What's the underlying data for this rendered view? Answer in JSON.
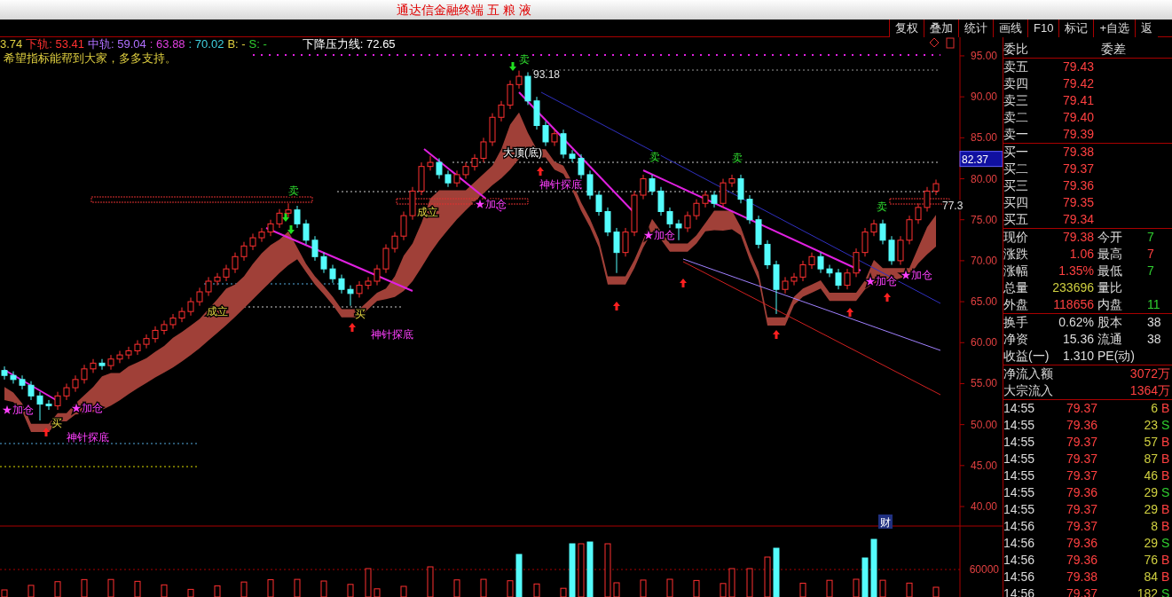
{
  "window": {
    "title": "通达信金融终端 五 粮 液"
  },
  "toolbar": [
    "复权",
    "叠加",
    "统计",
    "画线",
    "F10",
    "标记",
    "+自选",
    "返"
  ],
  "legend": [
    {
      "text": "3.74",
      "color": "#e0d040"
    },
    {
      "text": "下轨: 53.41",
      "color": "#ff3030"
    },
    {
      "text": "中轨: 59.04",
      "color": "#b070ff"
    },
    {
      "text": ": 63.88",
      "color": "#e040e0"
    },
    {
      "text": ": 70.02",
      "color": "#40d0e0"
    },
    {
      "text": "B: -",
      "color": "#e0d040"
    },
    {
      "text": "S: -",
      "color": "#30d030"
    },
    {
      "text": "下降压力线: 72.65",
      "color": "#ffffff"
    }
  ],
  "note": "希望指标能帮到大家，多多支持。",
  "annotations": [
    {
      "text": "卖",
      "kind": "sell"
    },
    {
      "text": "93.18",
      "kind": "price"
    },
    {
      "text": "大顶(底)",
      "kind": "top"
    },
    {
      "text": "神针探底",
      "kind": "probe"
    },
    {
      "text": "卖",
      "kind": "sell"
    },
    {
      "text": "卖",
      "kind": "sell"
    },
    {
      "text": "卖",
      "kind": "sell"
    },
    {
      "text": "卖",
      "kind": "sell"
    },
    {
      "text": "成立",
      "kind": "confirm"
    },
    {
      "text": "成立",
      "kind": "confirm"
    },
    {
      "text": "★加仓",
      "kind": "add"
    },
    {
      "text": "★加仓",
      "kind": "add"
    },
    {
      "text": "★加仓",
      "kind": "add"
    },
    {
      "text": "★加仓",
      "kind": "add"
    },
    {
      "text": "★加仓",
      "kind": "add"
    },
    {
      "text": "★加仓",
      "kind": "add"
    },
    {
      "text": "神针探底",
      "kind": "probe"
    },
    {
      "text": "神针探底",
      "kind": "probe"
    },
    {
      "text": "77.3",
      "kind": "price"
    },
    {
      "text": "买",
      "kind": "buy"
    },
    {
      "text": "买",
      "kind": "buy"
    }
  ],
  "chart_data": {
    "type": "candlestick",
    "ylim": [
      28.96,
      97.27
    ],
    "yticks": [
      {
        "value": 95,
        "label": "95.00"
      },
      {
        "value": 90,
        "label": "90.00"
      },
      {
        "value": 85,
        "label": "85.00"
      },
      {
        "value": 80,
        "label": "80.00"
      },
      {
        "value": 75,
        "label": "75.00"
      },
      {
        "value": 70,
        "label": "70.00"
      },
      {
        "value": 65,
        "label": "65.00"
      },
      {
        "value": 60,
        "label": "60.00"
      },
      {
        "value": 55,
        "label": "55.00"
      },
      {
        "value": 50,
        "label": "50.00"
      },
      {
        "value": 45,
        "label": "45.00"
      },
      {
        "value": 40,
        "label": "40.00"
      }
    ],
    "ohlc": [
      [
        56.6,
        57.1,
        55.5,
        56
      ],
      [
        56,
        56.5,
        55,
        55.5
      ],
      [
        55.5,
        56,
        54.3,
        54.8
      ],
      [
        54.8,
        55.3,
        53,
        53.5
      ],
      [
        53.5,
        54,
        50.5,
        52.5
      ],
      [
        52.5,
        53,
        51.8,
        52.3
      ],
      [
        52.3,
        54,
        51.8,
        53.5
      ],
      [
        53.5,
        55,
        53,
        54.5
      ],
      [
        54.5,
        56,
        54,
        55.5
      ],
      [
        55.5,
        57.3,
        55,
        56.8
      ],
      [
        56.8,
        58,
        56.3,
        57.5
      ],
      [
        57.5,
        58,
        56.7,
        57.2
      ],
      [
        57.2,
        58.5,
        56.7,
        58
      ],
      [
        58,
        59,
        57.5,
        58.5
      ],
      [
        58.5,
        59.5,
        58,
        59
      ],
      [
        59,
        60.3,
        58.5,
        59.8
      ],
      [
        59.8,
        61,
        59.3,
        60.5
      ],
      [
        60.5,
        62,
        60,
        61.5
      ],
      [
        61.5,
        62.7,
        61,
        62.2
      ],
      [
        62.2,
        63.5,
        61.7,
        63
      ],
      [
        63,
        64.3,
        62.5,
        63.8
      ],
      [
        63.8,
        65.5,
        63.3,
        65
      ],
      [
        65,
        66.7,
        64.5,
        66.2
      ],
      [
        66.2,
        68,
        65.7,
        67.5
      ],
      [
        67.5,
        68.5,
        67,
        68
      ],
      [
        68,
        69.5,
        67.5,
        69
      ],
      [
        69,
        71,
        68.5,
        70.5
      ],
      [
        70.5,
        72.3,
        70,
        71.8
      ],
      [
        71.8,
        73.3,
        71.3,
        72.8
      ],
      [
        72.8,
        74,
        72.3,
        73.5
      ],
      [
        73.5,
        75,
        73,
        74.5
      ],
      [
        74.5,
        76.3,
        74,
        75.8
      ],
      [
        75.8,
        77,
        75.3,
        76.2
      ],
      [
        76.2,
        76.7,
        74,
        74.5
      ],
      [
        74.5,
        75,
        72,
        72.5
      ],
      [
        72.5,
        73,
        70,
        70.5
      ],
      [
        70.5,
        71,
        68.5,
        69
      ],
      [
        69,
        69.5,
        67.3,
        67.8
      ],
      [
        67.8,
        68.3,
        66,
        66.5
      ],
      [
        66.5,
        67,
        64.5,
        66
      ],
      [
        66,
        67.5,
        65.5,
        67
      ],
      [
        67,
        68,
        66.5,
        67.5
      ],
      [
        67.5,
        69.5,
        67,
        69
      ],
      [
        69,
        72,
        68.5,
        71.5
      ],
      [
        71.5,
        73.5,
        71,
        73
      ],
      [
        73,
        76,
        72.5,
        75.5
      ],
      [
        75.5,
        79,
        75,
        78.5
      ],
      [
        78.5,
        82,
        78,
        81.5
      ],
      [
        81.5,
        82.8,
        81,
        82
      ],
      [
        82,
        82.5,
        80,
        80.5
      ],
      [
        80.5,
        81,
        79,
        79.5
      ],
      [
        79.5,
        81,
        79,
        80.5
      ],
      [
        80.5,
        82,
        80,
        81.5
      ],
      [
        81.5,
        83,
        81,
        82.5
      ],
      [
        82.5,
        85,
        82,
        84.5
      ],
      [
        84.5,
        88,
        84,
        87.5
      ],
      [
        87.5,
        89.5,
        87,
        89
      ],
      [
        89,
        92,
        88.5,
        91.5
      ],
      [
        91.5,
        93.2,
        91,
        92.5
      ],
      [
        92.5,
        93,
        89,
        89.5
      ],
      [
        89.5,
        90,
        86,
        86.5
      ],
      [
        86.5,
        87,
        84,
        84.5
      ],
      [
        84.5,
        86,
        84,
        85.5
      ],
      [
        85.5,
        86,
        82.5,
        83
      ],
      [
        83,
        83.5,
        82,
        82.5
      ],
      [
        82.5,
        83,
        80,
        80.5
      ],
      [
        80.5,
        81,
        77.5,
        78
      ],
      [
        78,
        78.5,
        75.5,
        76
      ],
      [
        76,
        76.5,
        73,
        73.5
      ],
      [
        73.5,
        74,
        68.5,
        71
      ],
      [
        71,
        74,
        70.5,
        73.5
      ],
      [
        73.5,
        78.5,
        73,
        78
      ],
      [
        78,
        80.5,
        77.5,
        80
      ],
      [
        80,
        80.5,
        78,
        78.5
      ],
      [
        78.5,
        79,
        75.5,
        76
      ],
      [
        76,
        76.5,
        74,
        74.5
      ],
      [
        74.5,
        75,
        72.5,
        74
      ],
      [
        74,
        76,
        73.5,
        75.5
      ],
      [
        75.5,
        77.5,
        75,
        77
      ],
      [
        77,
        78.5,
        76.5,
        78
      ],
      [
        78,
        78.5,
        76.5,
        77
      ],
      [
        77,
        80,
        76.5,
        79.5
      ],
      [
        79.5,
        80.5,
        79,
        80
      ],
      [
        80,
        80.5,
        77,
        77.5
      ],
      [
        77.5,
        78,
        74.5,
        75
      ],
      [
        75,
        75.5,
        71.5,
        72
      ],
      [
        72,
        72.5,
        69,
        69.5
      ],
      [
        69.5,
        70,
        63.5,
        66.5
      ],
      [
        66.5,
        68,
        66,
        67.5
      ],
      [
        67.5,
        68.5,
        67,
        68
      ],
      [
        68,
        70,
        67.5,
        69.5
      ],
      [
        69.5,
        71,
        69,
        70.5
      ],
      [
        70.5,
        71,
        68.5,
        69
      ],
      [
        69,
        69.5,
        68,
        68.5
      ],
      [
        68.5,
        69,
        66.5,
        67
      ],
      [
        67,
        69,
        66.5,
        68.5
      ],
      [
        68.5,
        71.5,
        68,
        71
      ],
      [
        71,
        74,
        70.5,
        73.5
      ],
      [
        73.5,
        75,
        73,
        74.5
      ],
      [
        74.5,
        75,
        72,
        72.5
      ],
      [
        72.5,
        73,
        69.5,
        70
      ],
      [
        70,
        73,
        69.5,
        72.5
      ],
      [
        72.5,
        75.5,
        72,
        75
      ],
      [
        75,
        77,
        74.5,
        76.5
      ],
      [
        76.5,
        79,
        76,
        78.5
      ],
      [
        78.5,
        79.9,
        78,
        79.4
      ]
    ]
  },
  "finance_marker": "财",
  "price_axis": {
    "marker": "82.37"
  },
  "volume_axis": {
    "ticks": [
      "60000"
    ]
  },
  "quote": {
    "order_ratio": [
      "委比",
      "委差"
    ],
    "asks": [
      {
        "label": "卖五",
        "price": "79.43"
      },
      {
        "label": "卖四",
        "price": "79.42"
      },
      {
        "label": "卖三",
        "price": "79.41"
      },
      {
        "label": "卖二",
        "price": "79.40"
      },
      {
        "label": "卖一",
        "price": "79.39"
      }
    ],
    "bids": [
      {
        "label": "买一",
        "price": "79.38"
      },
      {
        "label": "买二",
        "price": "79.37"
      },
      {
        "label": "买三",
        "price": "79.36"
      },
      {
        "label": "买四",
        "price": "79.35"
      },
      {
        "label": "买五",
        "price": "79.34"
      }
    ],
    "stats": [
      [
        {
          "label": "现价",
          "value": "79.38",
          "color": "#ff4040"
        },
        {
          "label": "今开",
          "value": "7",
          "color": "#30d030"
        }
      ],
      [
        {
          "label": "涨跌",
          "value": "1.06",
          "color": "#ff4040"
        },
        {
          "label": "最高",
          "value": "7",
          "color": "#ff4040"
        }
      ],
      [
        {
          "label": "涨幅",
          "value": "1.35%",
          "color": "#ff4040"
        },
        {
          "label": "最低",
          "value": "7",
          "color": "#30d030"
        }
      ],
      [
        {
          "label": "总量",
          "value": "233696",
          "color": "#d0d040"
        },
        {
          "label": "量比"
        }
      ],
      [
        {
          "label": "外盘",
          "value": "118656",
          "color": "#ff4040"
        },
        {
          "label": "内盘",
          "value": "11",
          "color": "#30d030"
        }
      ]
    ],
    "info": [
      [
        {
          "label": "换手",
          "value": "0.62%",
          "color": "#dddddd"
        },
        {
          "label": "股本",
          "value": "38",
          "color": "#dddddd"
        }
      ],
      [
        {
          "label": "净资",
          "value": "15.36",
          "color": "#dddddd"
        },
        {
          "label": "流通",
          "value": "38",
          "color": "#dddddd"
        }
      ],
      [
        {
          "label": "收益(一)",
          "value": "1.310",
          "color": "#dddddd"
        },
        {
          "label": "PE(动)"
        }
      ]
    ],
    "flows": [
      {
        "label": "净流入额",
        "value": "3072万"
      },
      {
        "label": "大宗流入",
        "value": "1364万"
      }
    ],
    "ticks": [
      {
        "time": "14:55",
        "price": "79.37",
        "volume": "6",
        "side": "B",
        "color": "#ff4040"
      },
      {
        "time": "14:55",
        "price": "79.36",
        "volume": "23",
        "side": "S",
        "color": "#30d030"
      },
      {
        "time": "14:55",
        "price": "79.37",
        "volume": "57",
        "side": "B",
        "color": "#ff4040"
      },
      {
        "time": "14:55",
        "price": "79.37",
        "volume": "87",
        "side": "B",
        "color": "#ff4040"
      },
      {
        "time": "14:55",
        "price": "79.37",
        "volume": "46",
        "side": "B",
        "color": "#ff4040"
      },
      {
        "time": "14:55",
        "price": "79.36",
        "volume": "29",
        "side": "S",
        "color": "#30d030"
      },
      {
        "time": "14:55",
        "price": "79.37",
        "volume": "29",
        "side": "B",
        "color": "#ff4040"
      },
      {
        "time": "14:56",
        "price": "79.37",
        "volume": "8",
        "side": "B",
        "color": "#ff4040"
      },
      {
        "time": "14:56",
        "price": "79.36",
        "volume": "29",
        "side": "S",
        "color": "#30d030"
      },
      {
        "time": "14:56",
        "price": "79.36",
        "volume": "76",
        "side": "B",
        "color": "#ff4040"
      },
      {
        "time": "14:56",
        "price": "79.38",
        "volume": "84",
        "side": "B",
        "color": "#ff4040"
      },
      {
        "time": "14:56",
        "price": "79.37",
        "volume": "182",
        "side": "S",
        "color": "#30d030"
      }
    ]
  }
}
